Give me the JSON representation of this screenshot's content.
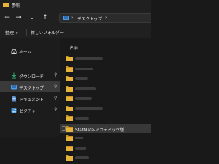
{
  "window": {
    "title": "参照"
  },
  "nav": {
    "back": "←",
    "forward": "→",
    "history": "⌄",
    "up": "↑",
    "address_segments": [
      "デスクトップ"
    ],
    "separator": "›"
  },
  "commandbar": {
    "organize_label": "整理",
    "organize_chevron": "▾",
    "new_folder_label": "新しいフォルダー"
  },
  "sidebar": {
    "items": [
      {
        "label": "ホーム",
        "icon": "home-icon",
        "pinned": false,
        "selected": false
      },
      {
        "label": "ダウンロード",
        "icon": "download-icon",
        "pinned": true,
        "selected": false
      },
      {
        "label": "デスクトップ",
        "icon": "desktop-icon",
        "pinned": true,
        "selected": true
      },
      {
        "label": "ドキュメント",
        "icon": "document-icon",
        "pinned": true,
        "selected": false
      },
      {
        "label": "ピクチャ",
        "icon": "picture-icon",
        "pinned": true,
        "selected": false
      }
    ],
    "pin_glyph": "📌"
  },
  "main": {
    "column_header": "名前",
    "rows": [
      {
        "name": "",
        "selected": false
      },
      {
        "name": "",
        "selected": false
      },
      {
        "name": "",
        "selected": false
      },
      {
        "name": "",
        "selected": false
      },
      {
        "name": "",
        "selected": false
      },
      {
        "name": "",
        "selected": false
      },
      {
        "name": "",
        "selected": false
      },
      {
        "name": "StatMate-アカデミック版",
        "selected": true
      },
      {
        "name": "",
        "selected": false
      },
      {
        "name": "",
        "selected": false
      },
      {
        "name": "",
        "selected": false
      }
    ]
  },
  "colors": {
    "folder": "#e8b339",
    "selection": "#383838",
    "accent_blue": "#4c9be8"
  }
}
